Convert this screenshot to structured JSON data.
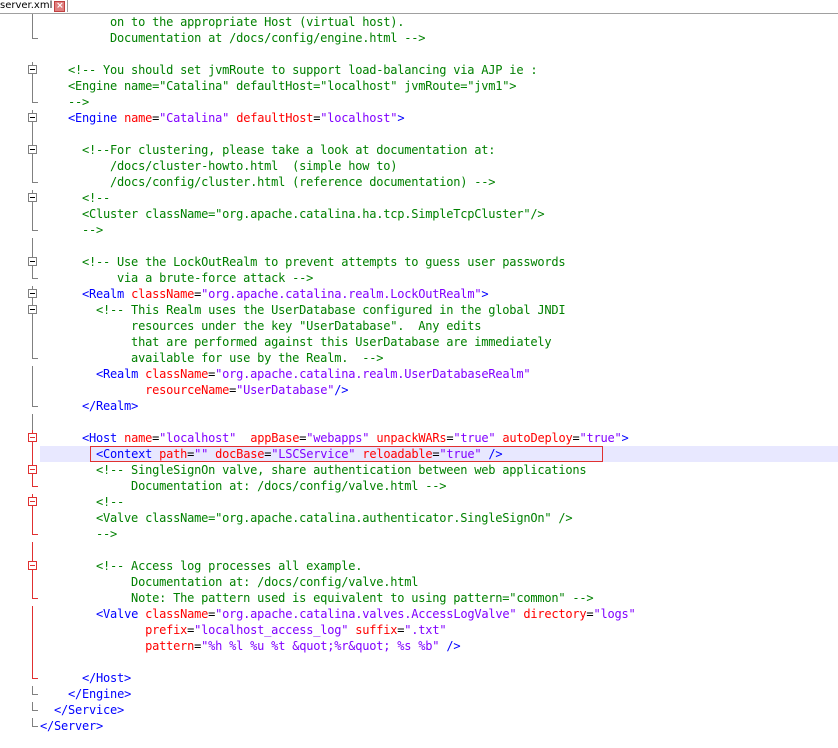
{
  "tab": {
    "label": "server.xml",
    "close_icon": "close-icon"
  },
  "colors": {
    "comment": "#008000",
    "tag": "#0000ff",
    "attribute": "#ff0000",
    "value": "#8000ff",
    "highlight_border": "#e03030",
    "current_line": "#e8e8ff"
  },
  "editor": {
    "highlighted_line": "4",
    "lines": [
      {
        "n": "7",
        "fold": "line",
        "segs": [
          [
            "c",
            "          on to the appropriate Host (virtual host)."
          ]
        ]
      },
      {
        "n": "8",
        "fold": "end",
        "segs": [
          [
            "c",
            "          Documentation at /docs/config/engine.html -->"
          ]
        ]
      },
      {
        "n": "9",
        "fold": "none",
        "segs": []
      },
      {
        "n": "0",
        "fold": "box",
        "segs": [
          [
            "c",
            "    <!-- You should set jvmRoute to support load-balancing via AJP ie :"
          ]
        ]
      },
      {
        "n": "1",
        "fold": "line",
        "segs": [
          [
            "c",
            "    <Engine name=\"Catalina\" defaultHost=\"localhost\" jvmRoute=\"jvm1\">"
          ]
        ]
      },
      {
        "n": "2",
        "fold": "end",
        "segs": [
          [
            "c",
            "    -->"
          ]
        ]
      },
      {
        "n": "3",
        "fold": "box",
        "segs": [
          [
            "x",
            "    "
          ],
          [
            "t",
            "<Engine "
          ],
          [
            "a",
            "name"
          ],
          [
            "x",
            "="
          ],
          [
            "v",
            "\"Catalina\""
          ],
          [
            "x",
            " "
          ],
          [
            "a",
            "defaultHost"
          ],
          [
            "x",
            "="
          ],
          [
            "v",
            "\"localhost\""
          ],
          [
            "t",
            ">"
          ]
        ]
      },
      {
        "n": "4",
        "fold": "line",
        "segs": []
      },
      {
        "n": "5",
        "fold": "box",
        "segs": [
          [
            "c",
            "      <!--For clustering, please take a look at documentation at:"
          ]
        ]
      },
      {
        "n": "6",
        "fold": "line",
        "segs": [
          [
            "c",
            "          /docs/cluster-howto.html  (simple how to)"
          ]
        ]
      },
      {
        "n": "7",
        "fold": "end",
        "segs": [
          [
            "c",
            "          /docs/config/cluster.html (reference documentation) -->"
          ]
        ]
      },
      {
        "n": "8",
        "fold": "box",
        "segs": [
          [
            "c",
            "      <!--"
          ]
        ]
      },
      {
        "n": "9",
        "fold": "line",
        "segs": [
          [
            "c",
            "      <Cluster className=\"org.apache.catalina.ha.tcp.SimpleTcpCluster\"/>"
          ]
        ]
      },
      {
        "n": "0",
        "fold": "end",
        "segs": [
          [
            "c",
            "      -->"
          ]
        ]
      },
      {
        "n": "1",
        "fold": "line",
        "segs": []
      },
      {
        "n": "2",
        "fold": "box",
        "segs": [
          [
            "c",
            "      <!-- Use the LockOutRealm to prevent attempts to guess user passwords"
          ]
        ]
      },
      {
        "n": "3",
        "fold": "end",
        "segs": [
          [
            "c",
            "           via a brute-force attack -->"
          ]
        ]
      },
      {
        "n": "4",
        "fold": "box",
        "segs": [
          [
            "x",
            "      "
          ],
          [
            "t",
            "<Realm "
          ],
          [
            "a",
            "className"
          ],
          [
            "x",
            "="
          ],
          [
            "v",
            "\"org.apache.catalina.realm.LockOutRealm\""
          ],
          [
            "t",
            ">"
          ]
        ]
      },
      {
        "n": "5",
        "fold": "box",
        "segs": [
          [
            "c",
            "        <!-- This Realm uses the UserDatabase configured in the global JNDI"
          ]
        ]
      },
      {
        "n": "6",
        "fold": "line",
        "segs": [
          [
            "c",
            "             resources under the key \"UserDatabase\".  Any edits"
          ]
        ]
      },
      {
        "n": "7",
        "fold": "line",
        "segs": [
          [
            "c",
            "             that are performed against this UserDatabase are immediately"
          ]
        ]
      },
      {
        "n": "8",
        "fold": "end",
        "segs": [
          [
            "c",
            "             available for use by the Realm.  -->"
          ]
        ]
      },
      {
        "n": "9",
        "fold": "line",
        "segs": [
          [
            "x",
            "        "
          ],
          [
            "t",
            "<Realm "
          ],
          [
            "a",
            "className"
          ],
          [
            "x",
            "="
          ],
          [
            "v",
            "\"org.apache.catalina.realm.UserDatabaseRealm\""
          ]
        ]
      },
      {
        "n": "0",
        "fold": "line",
        "segs": [
          [
            "x",
            "               "
          ],
          [
            "a",
            "resourceName"
          ],
          [
            "x",
            "="
          ],
          [
            "v",
            "\"UserDatabase\""
          ],
          [
            "t",
            "/>"
          ]
        ]
      },
      {
        "n": "1",
        "fold": "end",
        "segs": [
          [
            "x",
            "      "
          ],
          [
            "t",
            "</Realm>"
          ]
        ]
      },
      {
        "n": "2",
        "fold": "line",
        "segs": []
      },
      {
        "n": "3",
        "fold": "boxred",
        "segs": [
          [
            "x",
            "      "
          ],
          [
            "t",
            "<Host "
          ],
          [
            "a",
            "name"
          ],
          [
            "x",
            "="
          ],
          [
            "v",
            "\"localhost\""
          ],
          [
            "x",
            "  "
          ],
          [
            "a",
            "appBase"
          ],
          [
            "x",
            "="
          ],
          [
            "v",
            "\"webapps\""
          ],
          [
            "x",
            " "
          ],
          [
            "a",
            "unpackWARs"
          ],
          [
            "x",
            "="
          ],
          [
            "v",
            "\"true\""
          ],
          [
            "x",
            " "
          ],
          [
            "a",
            "autoDeploy"
          ],
          [
            "x",
            "="
          ],
          [
            "v",
            "\"true\""
          ],
          [
            "t",
            ">"
          ]
        ]
      },
      {
        "n": "4",
        "fold": "red",
        "segs": [
          [
            "x",
            "        "
          ],
          [
            "t",
            "<Context "
          ],
          [
            "a",
            "path"
          ],
          [
            "x",
            "="
          ],
          [
            "v",
            "\"\""
          ],
          [
            "x",
            " "
          ],
          [
            "a",
            "docBase"
          ],
          [
            "x",
            "="
          ],
          [
            "v",
            "\"LSCService\""
          ],
          [
            "x",
            " "
          ],
          [
            "a",
            "reloadable"
          ],
          [
            "x",
            "="
          ],
          [
            "v",
            "\"true\""
          ],
          [
            "x",
            " "
          ],
          [
            "t",
            "/>"
          ]
        ]
      },
      {
        "n": "5",
        "fold": "boxred",
        "segs": [
          [
            "c",
            "        <!-- SingleSignOn valve, share authentication between web applications"
          ]
        ]
      },
      {
        "n": "6",
        "fold": "endred",
        "segs": [
          [
            "c",
            "             Documentation at: /docs/config/valve.html -->"
          ]
        ]
      },
      {
        "n": "7",
        "fold": "boxred",
        "segs": [
          [
            "c",
            "        <!--"
          ]
        ]
      },
      {
        "n": "8",
        "fold": "red",
        "segs": [
          [
            "c",
            "        <Valve className=\"org.apache.catalina.authenticator.SingleSignOn\" />"
          ]
        ]
      },
      {
        "n": "9",
        "fold": "endred",
        "segs": [
          [
            "c",
            "        -->"
          ]
        ]
      },
      {
        "n": "0",
        "fold": "red",
        "segs": []
      },
      {
        "n": "1",
        "fold": "boxred",
        "segs": [
          [
            "c",
            "        <!-- Access log processes all example."
          ]
        ]
      },
      {
        "n": "2",
        "fold": "red",
        "segs": [
          [
            "c",
            "             Documentation at: /docs/config/valve.html"
          ]
        ]
      },
      {
        "n": "3",
        "fold": "endred",
        "segs": [
          [
            "c",
            "             Note: The pattern used is equivalent to using pattern=\"common\" -->"
          ]
        ]
      },
      {
        "n": "4",
        "fold": "red",
        "segs": [
          [
            "x",
            "        "
          ],
          [
            "t",
            "<Valve "
          ],
          [
            "a",
            "className"
          ],
          [
            "x",
            "="
          ],
          [
            "v",
            "\"org.apache.catalina.valves.AccessLogValve\""
          ],
          [
            "x",
            " "
          ],
          [
            "a",
            "directory"
          ],
          [
            "x",
            "="
          ],
          [
            "v",
            "\"logs\""
          ]
        ]
      },
      {
        "n": "5",
        "fold": "red",
        "segs": [
          [
            "x",
            "               "
          ],
          [
            "a",
            "prefix"
          ],
          [
            "x",
            "="
          ],
          [
            "v",
            "\"localhost_access_log\""
          ],
          [
            "x",
            " "
          ],
          [
            "a",
            "suffix"
          ],
          [
            "x",
            "="
          ],
          [
            "v",
            "\".txt\""
          ]
        ]
      },
      {
        "n": "6",
        "fold": "red",
        "segs": [
          [
            "x",
            "               "
          ],
          [
            "a",
            "pattern"
          ],
          [
            "x",
            "="
          ],
          [
            "v",
            "\"%h %l %u %t &quot;%r&quot; %s %b\""
          ],
          [
            "x",
            " "
          ],
          [
            "t",
            "/>"
          ]
        ]
      },
      {
        "n": "7",
        "fold": "red",
        "segs": []
      },
      {
        "n": "8",
        "fold": "endred",
        "segs": [
          [
            "x",
            "      "
          ],
          [
            "t",
            "</Host>"
          ]
        ]
      },
      {
        "n": "9",
        "fold": "end",
        "segs": [
          [
            "x",
            "    "
          ],
          [
            "t",
            "</Engine>"
          ]
        ]
      },
      {
        "n": "0",
        "fold": "end",
        "segs": [
          [
            "x",
            "  "
          ],
          [
            "t",
            "</Service>"
          ]
        ]
      },
      {
        "n": "1",
        "fold": "end",
        "segs": [
          [
            "t",
            "</Server>"
          ]
        ]
      }
    ]
  }
}
